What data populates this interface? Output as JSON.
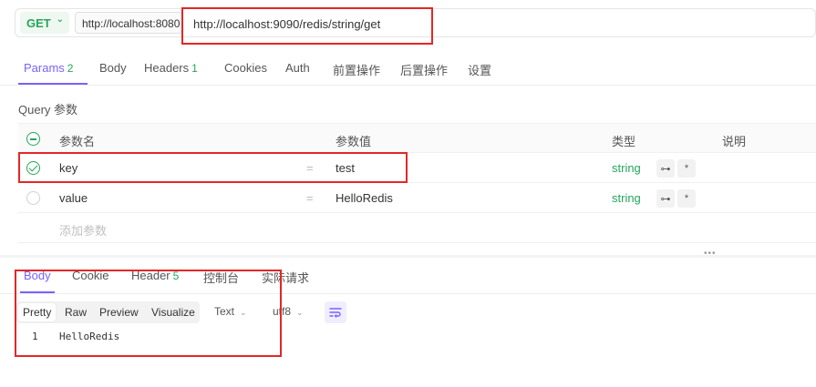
{
  "request": {
    "method": "GET",
    "env_url": "http://localhost:8080",
    "url": "http://localhost:9090/redis/string/get"
  },
  "req_tabs": [
    {
      "label": "Params",
      "count": "2"
    },
    {
      "label": "Body"
    },
    {
      "label": "Headers",
      "count": "1"
    },
    {
      "label": "Cookies"
    },
    {
      "label": "Auth"
    },
    {
      "label": "前置操作"
    },
    {
      "label": "后置操作"
    },
    {
      "label": "设置"
    }
  ],
  "query": {
    "title": "Query 参数",
    "headers": {
      "name": "参数名",
      "value": "参数值",
      "type": "类型",
      "desc": "说明"
    },
    "rows": [
      {
        "name": "key",
        "value": "test",
        "type": "string",
        "checked": true,
        "eq": "="
      },
      {
        "name": "value",
        "value": "HelloRedis",
        "type": "string",
        "checked": false,
        "eq": "="
      }
    ],
    "add_placeholder": "添加参数",
    "link_icon_glyph": "⊶",
    "required_glyph": "*"
  },
  "res_tabs": [
    {
      "label": "Body"
    },
    {
      "label": "Cookie"
    },
    {
      "label": "Header",
      "count": "5"
    },
    {
      "label": "控制台"
    },
    {
      "label": "实际请求"
    }
  ],
  "view_modes": [
    "Pretty",
    "Raw",
    "Preview",
    "Visualize"
  ],
  "format": {
    "type": "Text",
    "encoding": "utf8"
  },
  "response": {
    "line_no": "1",
    "text": "HelloRedis"
  },
  "colors": {
    "accent": "#7b61ff",
    "method": "#25a65a",
    "highlight": "#e32727"
  }
}
